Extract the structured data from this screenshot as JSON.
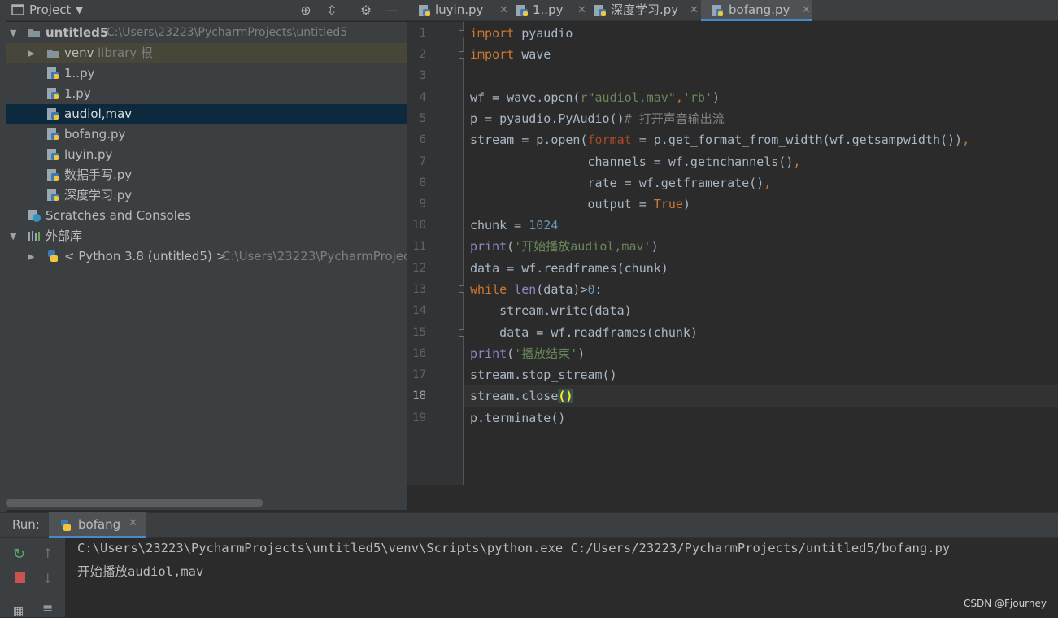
{
  "project_panel": {
    "title": "Project",
    "tree": [
      {
        "name": "untitled5",
        "path": "C:\\Users\\23223\\PycharmProjects\\untitled5"
      },
      {
        "name": "venv",
        "suffix": "library 根"
      },
      {
        "name": "1..py"
      },
      {
        "name": "1.py"
      },
      {
        "name": "audiol,mav"
      },
      {
        "name": "bofang.py"
      },
      {
        "name": "luyin.py"
      },
      {
        "name": "数据手写.py"
      },
      {
        "name": "深度学习.py"
      },
      {
        "name": "Scratches and Consoles"
      },
      {
        "name": "外部库"
      },
      {
        "name": "< Python 3.8 (untitled5) >",
        "path": "C:\\Users\\23223\\PycharmProjec"
      }
    ]
  },
  "tabs": [
    {
      "label": "luyin.py"
    },
    {
      "label": "1..py"
    },
    {
      "label": "深度学习.py"
    },
    {
      "label": "bofang.py",
      "active": true
    }
  ],
  "editor": {
    "line_numbers": [
      "1",
      "2",
      "3",
      "4",
      "5",
      "6",
      "7",
      "8",
      "9",
      "10",
      "11",
      "12",
      "13",
      "14",
      "15",
      "16",
      "17",
      "18",
      "19"
    ],
    "current_line": 18,
    "code": [
      "import pyaudio",
      "import wave",
      "",
      "wf = wave.open(r\"audiol,mav\",'rb')",
      "p = pyaudio.PyAudio()# 打开声音输出流",
      "stream = p.open(format = p.get_format_from_width(wf.getsampwidth()),",
      "                channels = wf.getnchannels(),",
      "                rate = wf.getframerate(),",
      "                output = True)",
      "chunk = 1024",
      "print('开始播放audiol,mav')",
      "data = wf.readframes(chunk)",
      "while len(data)>0:",
      "    stream.write(data)",
      "    data = wf.readframes(chunk)",
      "print('播放结束')",
      "stream.stop_stream()",
      "stream.close()",
      "p.terminate()"
    ]
  },
  "run_panel": {
    "label": "Run:",
    "tab": "bofang",
    "output": [
      "C:\\Users\\23223\\PycharmProjects\\untitled5\\venv\\Scripts\\python.exe C:/Users/23223/PycharmProjects/untitled5/bofang.py",
      "开始播放audiol,mav"
    ]
  },
  "watermark": "CSDN @Fjourney",
  "colors": {
    "keyword": "#cc7832",
    "string": "#6a8759",
    "number": "#6897bb",
    "builtin": "#8888c6",
    "param": "#aa4926",
    "selection": "#0d293e",
    "accent": "#4a88c7"
  }
}
